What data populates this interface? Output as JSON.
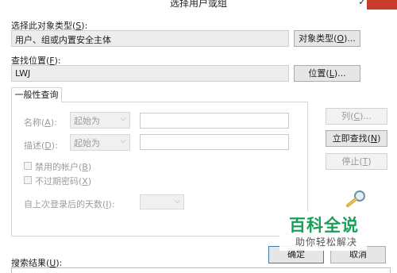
{
  "window": {
    "title": "选择用户或组",
    "min_icon": "minimize-icon",
    "close_icon": "close-icon",
    "accent_close": "#c83a2c"
  },
  "object_type": {
    "label_prefix": "选择此对象类型(",
    "label_key": "S",
    "label_suffix": "):",
    "value": "用户、组或内置安全主体",
    "button_prefix": "对象类型(",
    "button_key": "O",
    "button_suffix": ")..."
  },
  "location": {
    "label_prefix": "查找位置(",
    "label_key": "F",
    "label_suffix": "):",
    "value": "LWJ",
    "button_prefix": "位置(",
    "button_key": "L",
    "button_suffix": ")..."
  },
  "tab": {
    "label": "一般性查询"
  },
  "query": {
    "name_label_prefix": "名称(",
    "name_label_key": "A",
    "name_label_suffix": "):",
    "name_mode": "起始为",
    "desc_label_prefix": "描述(",
    "desc_label_key": "D",
    "desc_label_suffix": "):",
    "desc_mode": "起始为",
    "disabled_accounts_prefix": "禁用的帐户(",
    "disabled_accounts_key": "B",
    "disabled_accounts_suffix": ")",
    "nonexpiring_prefix": "不过期密码(",
    "nonexpiring_key": "X",
    "nonexpiring_suffix": ")",
    "days_label_prefix": "自上次登录后的天数(",
    "days_label_key": "I",
    "days_label_suffix": "):"
  },
  "side_buttons": {
    "columns_prefix": "列(",
    "columns_key": "C",
    "columns_suffix": ")...",
    "find_now_prefix": "立即查找(",
    "find_now_key": "N",
    "find_now_suffix": ")",
    "stop_prefix": "停止(",
    "stop_key": "T",
    "stop_suffix": ")",
    "search_icon": "search-magnifier-icon"
  },
  "footer": {
    "ok": "确定",
    "cancel": "取消",
    "results_prefix": "搜索结果(",
    "results_key": "U",
    "results_suffix": "):"
  },
  "watermark": {
    "main": "百科全说",
    "sub": "助你轻松解决"
  }
}
